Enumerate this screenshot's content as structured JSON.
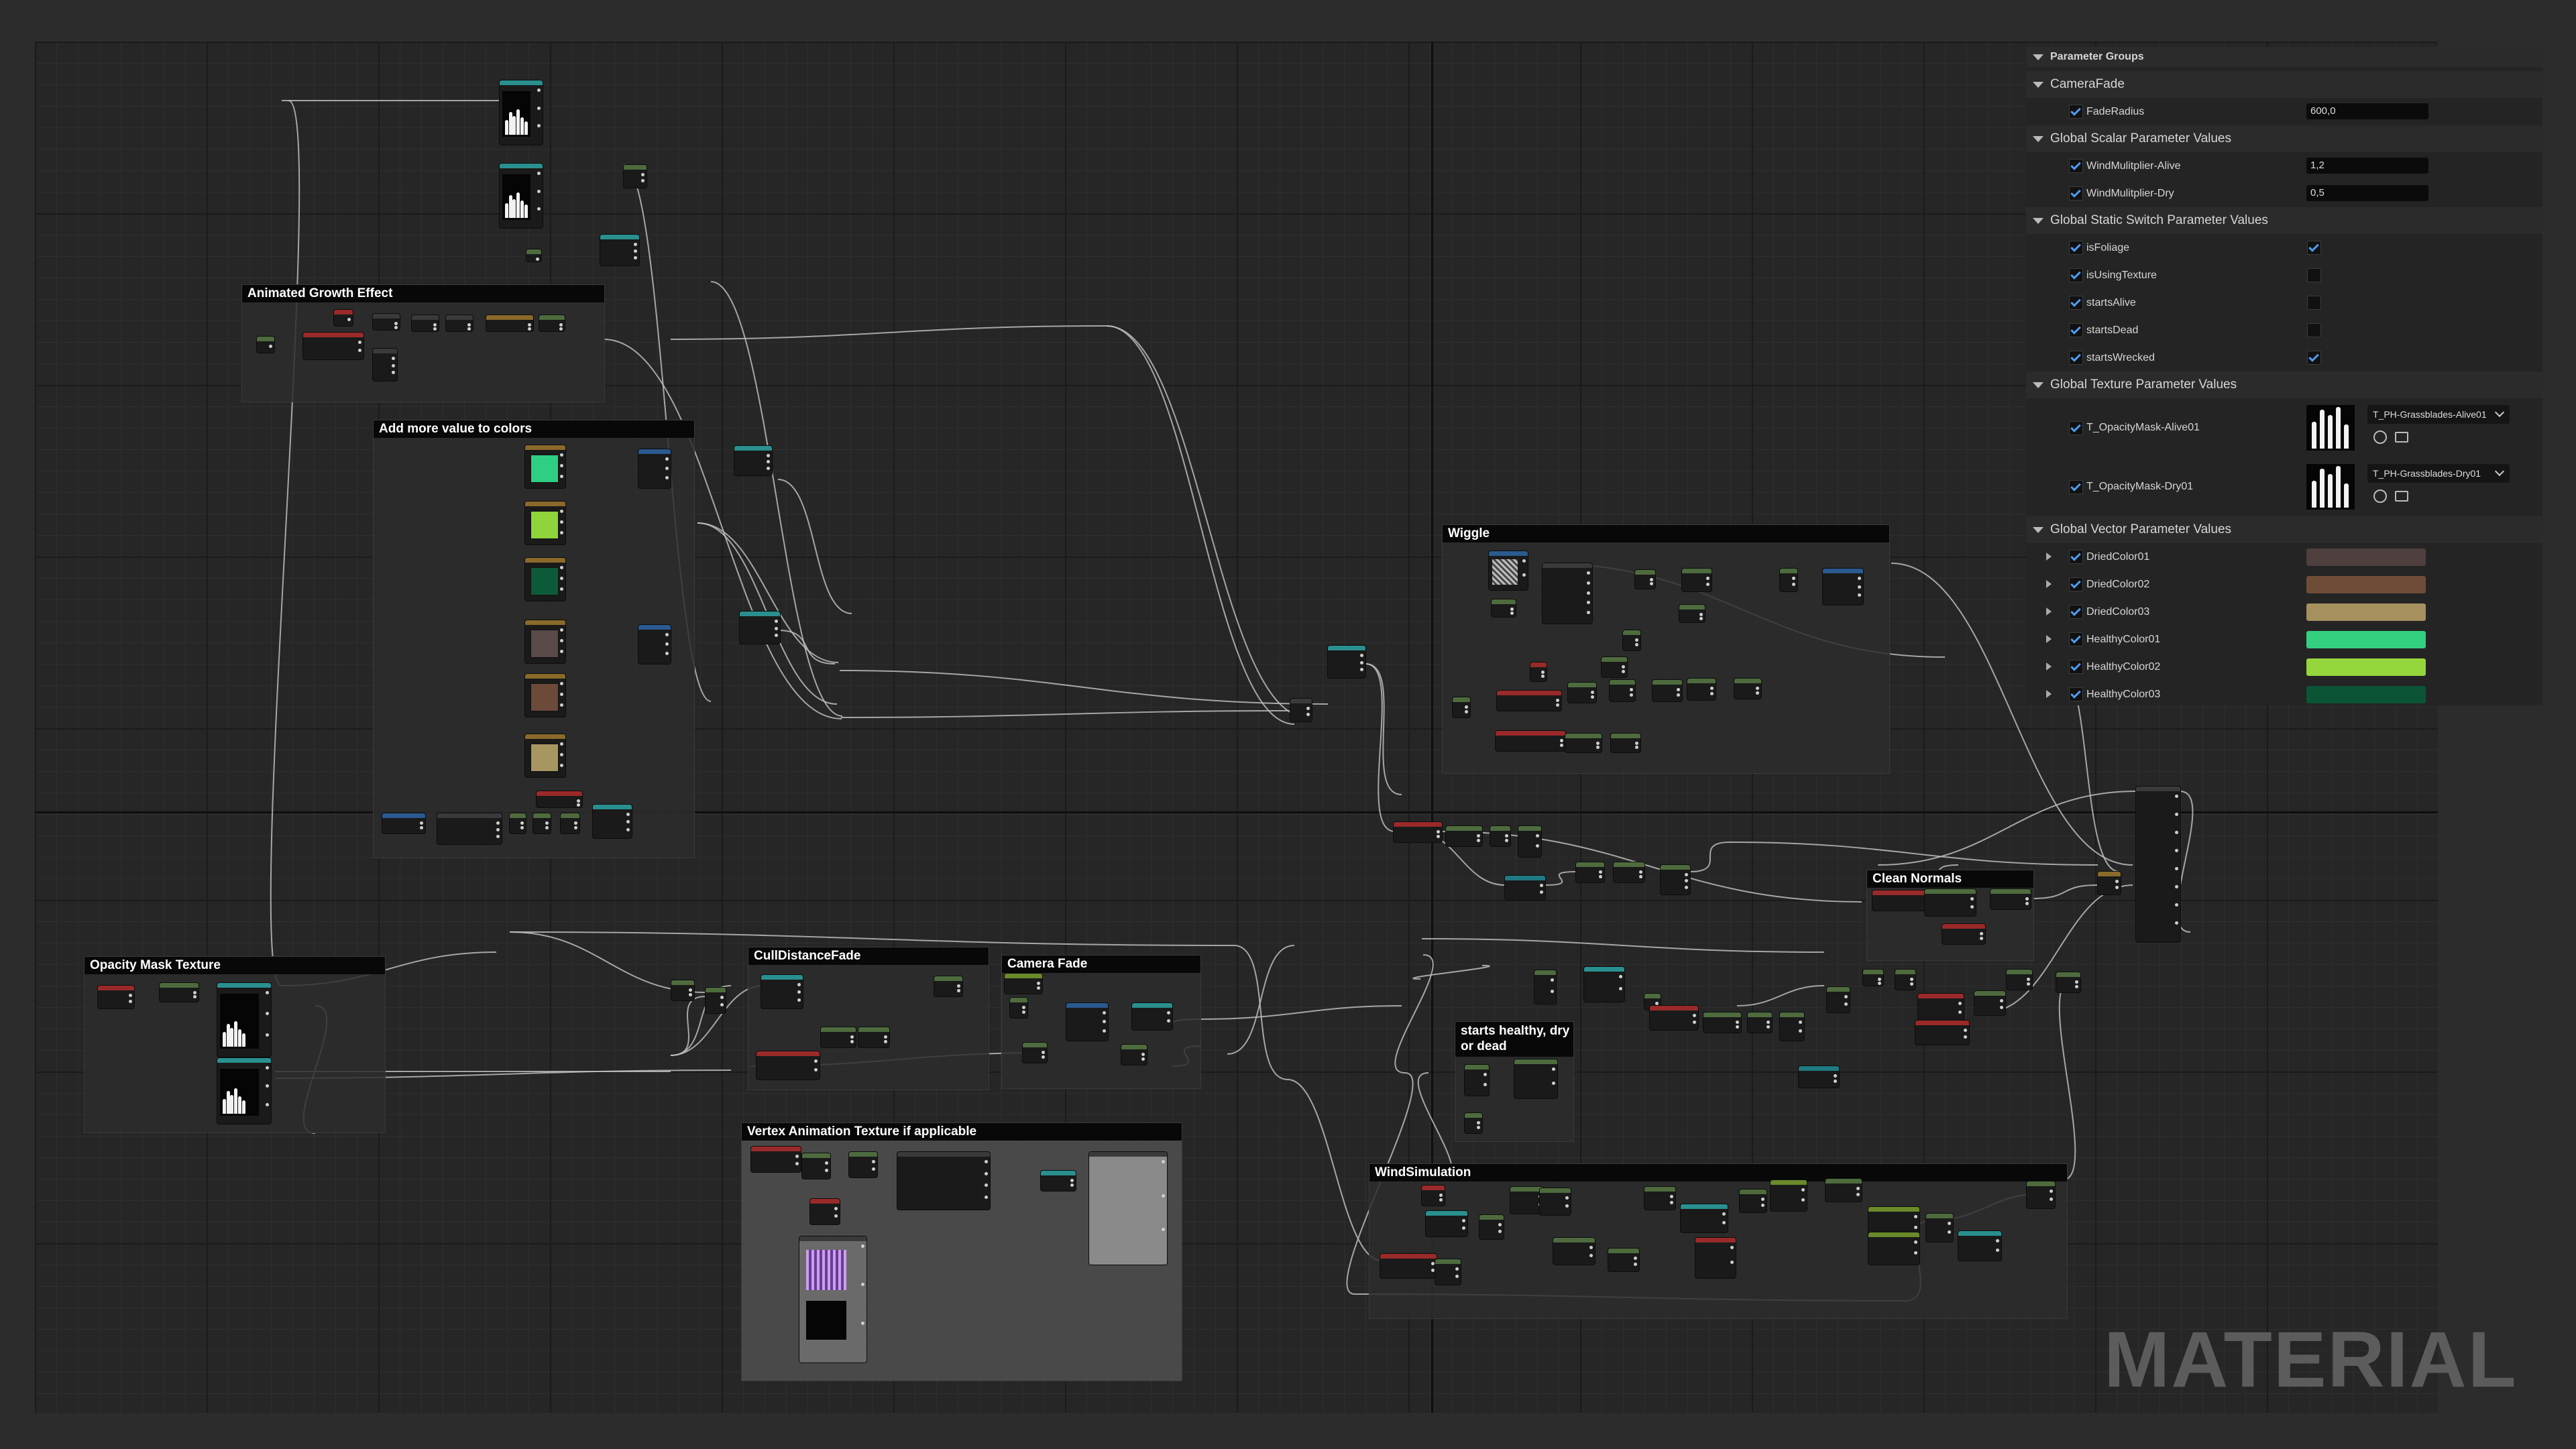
{
  "comments": [
    {
      "id": "animated_growth",
      "title": "Animated Growth Effect"
    },
    {
      "id": "add_value",
      "title": "Add more value to colors"
    },
    {
      "id": "opacity_mask",
      "title": "Opacity Mask Texture"
    },
    {
      "id": "cull_distance",
      "title": "CullDistanceFade"
    },
    {
      "id": "camera_fade",
      "title": "Camera Fade"
    },
    {
      "id": "vertex_anim",
      "title": "Vertex Animation Texture if applicable"
    },
    {
      "id": "wiggle",
      "title": "Wiggle"
    },
    {
      "id": "clean_normals",
      "title": "Clean Normals"
    },
    {
      "id": "starts_healthy",
      "title": "starts healthy, dry or dead"
    },
    {
      "id": "wind_sim",
      "title": "WindSimulation"
    }
  ],
  "color_swatches": [
    "#2ecf82",
    "#8fd43a",
    "#0d5a3a",
    "#5a4a4a",
    "#6b4a3a",
    "#a89660"
  ],
  "panel": {
    "header": "Parameter Groups",
    "groups": [
      {
        "name": "CameraFade",
        "params": [
          {
            "name": "FadeRadius",
            "checked": true,
            "type": "scalar",
            "value": "600,0"
          }
        ]
      },
      {
        "name": "Global Scalar Parameter Values",
        "params": [
          {
            "name": "WindMulitplier-Alive",
            "checked": true,
            "type": "scalar",
            "value": "1,2"
          },
          {
            "name": "WindMulitplier-Dry",
            "checked": true,
            "type": "scalar",
            "value": "0,5"
          }
        ]
      },
      {
        "name": "Global Static Switch Parameter Values",
        "params": [
          {
            "name": "isFoliage",
            "checked": true,
            "type": "switch",
            "value": true
          },
          {
            "name": "isUsingTexture",
            "checked": true,
            "type": "switch",
            "value": false
          },
          {
            "name": "startsAlive",
            "checked": true,
            "type": "switch",
            "value": false
          },
          {
            "name": "startsDead",
            "checked": true,
            "type": "switch",
            "value": false
          },
          {
            "name": "startsWrecked",
            "checked": true,
            "type": "switch",
            "value": true
          }
        ]
      },
      {
        "name": "Global Texture Parameter Values",
        "params": [
          {
            "name": "T_OpacityMask-Alive01",
            "checked": true,
            "type": "texture",
            "asset": "T_PH-Grassblades-Alive01"
          },
          {
            "name": "T_OpacityMask-Dry01",
            "checked": true,
            "type": "texture",
            "asset": "T_PH-Grassblades-Dry01"
          }
        ]
      },
      {
        "name": "Global Vector Parameter Values",
        "params": [
          {
            "name": "DriedColor01",
            "checked": true,
            "type": "vector",
            "color": "#4f3f3f"
          },
          {
            "name": "DriedColor02",
            "checked": true,
            "type": "vector",
            "color": "#6e4c38"
          },
          {
            "name": "DriedColor03",
            "checked": true,
            "type": "vector",
            "color": "#a5905e"
          },
          {
            "name": "HealthyColor01",
            "checked": true,
            "type": "vector",
            "color": "#33d17f"
          },
          {
            "name": "HealthyColor02",
            "checked": true,
            "type": "vector",
            "color": "#95d63c"
          },
          {
            "name": "HealthyColor03",
            "checked": true,
            "type": "vector",
            "color": "#0b5436"
          }
        ]
      }
    ]
  },
  "watermark": "MATERIAL"
}
